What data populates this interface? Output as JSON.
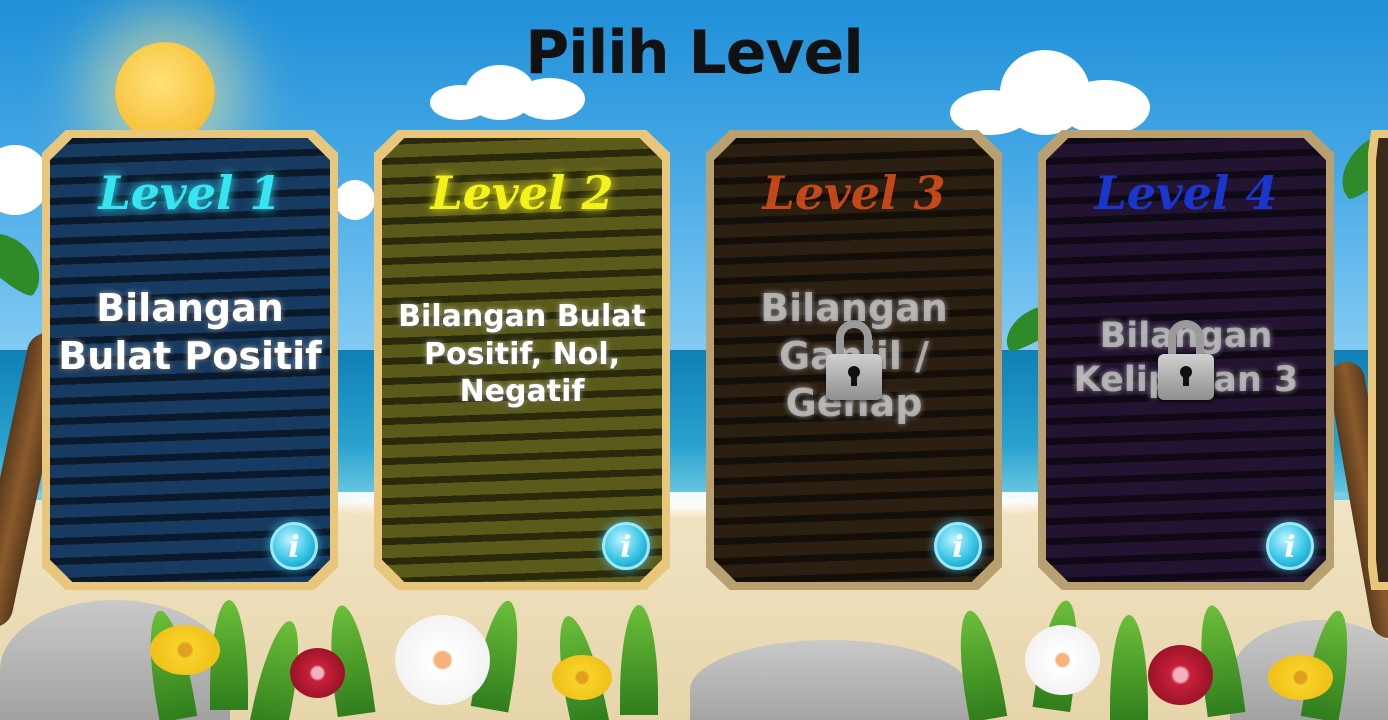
{
  "screen": {
    "title": "Pilih Level"
  },
  "levels": [
    {
      "label": "Level 1",
      "name": "Bilangan Bulat Positif",
      "locked": false,
      "label_color": "#35e6f2",
      "bg_color": "#173a60"
    },
    {
      "label": "Level 2",
      "name": "Bilangan Bulat Positif, Nol, Negatif",
      "locked": false,
      "label_color": "#f3f21a",
      "bg_color": "#5a5a1a"
    },
    {
      "label": "Level 3",
      "name": "Bilangan Ganjil / Genap",
      "locked": true,
      "label_color": "#e0501a",
      "bg_color": "#3a2a18"
    },
    {
      "label": "Level 4",
      "name": "Bilangan Kelipatan 3",
      "locked": true,
      "label_color": "#1a3ae0",
      "bg_color": "#2e1a40"
    }
  ],
  "info_button_glyph": "i",
  "icons": {
    "info": "info-icon",
    "lock": "lock-icon"
  }
}
